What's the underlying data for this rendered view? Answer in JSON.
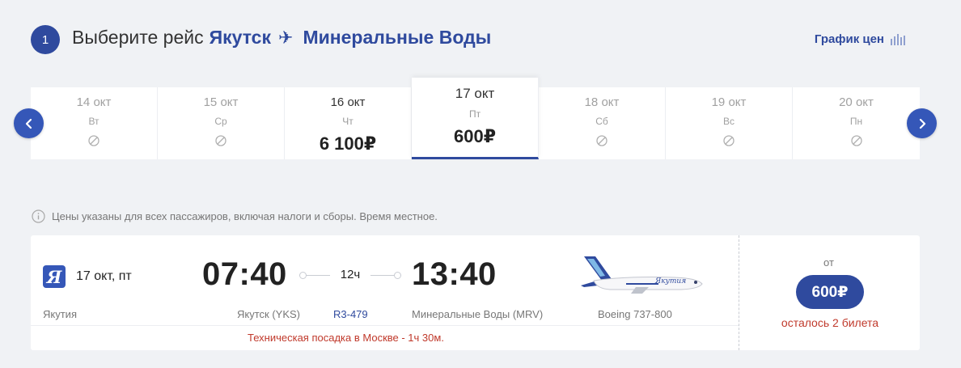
{
  "header": {
    "step": "1",
    "title_prefix": "Выберите рейс",
    "origin": "Якутск",
    "plane_glyph": "✈",
    "destination": "Минеральные Воды",
    "price_chart_label": "График цен"
  },
  "dates": [
    {
      "date": "14 окт",
      "weekday": "Вт",
      "price": null
    },
    {
      "date": "15 окт",
      "weekday": "Ср",
      "price": null
    },
    {
      "date": "16 окт",
      "weekday": "Чт",
      "price": "6 100₽"
    },
    {
      "date": "17 окт",
      "weekday": "Пт",
      "price": "600₽",
      "selected": true
    },
    {
      "date": "18 окт",
      "weekday": "Сб",
      "price": null
    },
    {
      "date": "19 окт",
      "weekday": "Вс",
      "price": null
    },
    {
      "date": "20 окт",
      "weekday": "Пн",
      "price": null
    }
  ],
  "nav": {
    "prev_icon": "chevron-left-icon",
    "next_icon": "chevron-right-icon"
  },
  "info_text": "Цены указаны для всех пассажиров, включая налоги и сборы. Время местное.",
  "flight": {
    "logo_letter": "Я",
    "date": "17 окт, пт",
    "airline": "Якутия",
    "departure_time": "07:40",
    "arrival_time": "13:40",
    "duration": "12ч",
    "departure_airport": "Якутск (YKS)",
    "flight_number": "R3-479",
    "arrival_airport": "Минеральные Воды (MRV)",
    "aircraft": "Boeing 737-800",
    "technical_stop": "Техническая посадка в Москве - 1ч 30м.",
    "from_label": "от",
    "price": "600₽",
    "seats_left": "осталось 2 билета"
  },
  "colors": {
    "accent": "#2f4a9e",
    "warning": "#c0392b",
    "background": "#f0f2f5"
  }
}
